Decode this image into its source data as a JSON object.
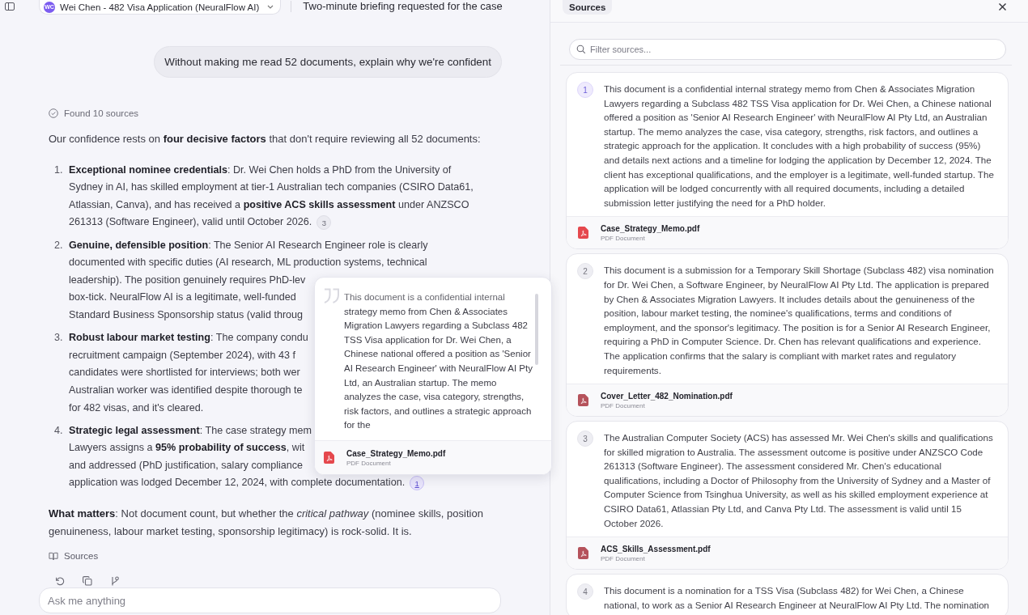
{
  "top_bar": {
    "case_selector": {
      "avatar": "WC",
      "label": "Wei Chen - 482 Visa Application (NeuralFlow AI)"
    },
    "title": "Two-minute briefing requested for the case"
  },
  "chat": {
    "user_message": "Without making me read 52 documents, explain why we're confident",
    "status": "Found 10 sources",
    "intro": "Our confidence rests on **four decisive factors** that don't require reviewing all 52 documents:",
    "factors": [
      {
        "number": "1.",
        "lines": [
          "**Exceptional nominee credentials**: Dr. Wei Chen holds a PhD from the University of",
          "Sydney in AI, has skilled employment at tier-1 Australian tech companies (CSIRO Data61,",
          "Atlassian, Canva), and has received a **positive ACS skills assessment** under ANZSCO",
          "261313 (Software Engineer), valid until October 2026."
        ],
        "citation": {
          "label": "3",
          "selected": false
        }
      },
      {
        "number": "2.",
        "lines": [
          "**Genuine, defensible position**: The Senior AI Research Engineer role is clearly",
          "documented with specific duties (AI research, ML production systems, technical",
          "leadership). The position genuinely requires PhD-lev",
          "box-tick. NeuralFlow AI is a legitimate, well-funded",
          "Standard Business Sponsorship status (valid throug"
        ]
      },
      {
        "number": "3.",
        "lines": [
          "**Robust labour market testing**: The company condu",
          "recruitment campaign (September 2024), with 43 f",
          "candidates were shortlisted for interviews; both wer",
          "Australian worker was identified despite thorough te",
          "for 482 visas, and it's cleared."
        ]
      },
      {
        "number": "4.",
        "lines": [
          "**Strategic legal assessment**: The case strategy mem",
          "Lawyers assigns a **95% probability of success**, wit",
          "and addressed (PhD justification, salary compliance",
          "application was lodged December 12, 2024, with complete documentation."
        ],
        "citation": {
          "label": "1",
          "selected": true
        }
      }
    ],
    "conclusion": "**What matters**: Not document count, but whether the *critical pathway* (nominee skills, position genuineness, labour market testing, sponsorship legitimacy) is rock-solid. It is.",
    "sources_link": "Sources",
    "input": {
      "placeholder": "Ask me anything"
    }
  },
  "citation_popover": {
    "excerpt": "This document is a confidential internal strategy memo from Chen & Associates Migration Lawyers regarding a Subclass 482 TSS Visa application for Dr. Wei Chen, a Chinese national offered a position as 'Senior AI Research Engineer' with NeuralFlow AI Pty Ltd, an Australian startup. The memo analyzes the case, visa category, strengths, risk factors, and outlines a strategic approach for the",
    "file": {
      "name": "Case_Strategy_Memo.pdf",
      "type": "PDF Document"
    }
  },
  "sources_panel": {
    "title": "Sources",
    "filter": {
      "placeholder": "Filter sources..."
    },
    "sources": [
      {
        "number": "1",
        "selected": true,
        "summary": "This document is a confidential internal strategy memo from Chen & Associates Migration Lawyers regarding a Subclass 482 TSS Visa application for Dr. Wei Chen, a Chinese national offered a position as 'Senior AI Research Engineer' with NeuralFlow AI Pty Ltd, an Australian startup. The memo analyzes the case, visa category, strengths, risk factors, and outlines a strategic approach for the application. It concludes with a high probability of success (95%) and details next actions and a timeline for lodging the application by December 12, 2024. The client has exceptional qualifications, and the employer is a legitimate, well-funded startup. The application will be lodged concurrently with all required documents, including a detailed submission letter justifying the need for a PhD holder.",
        "file": {
          "name": "Case_Strategy_Memo.pdf",
          "type": "PDF Document"
        }
      },
      {
        "number": "2",
        "selected": false,
        "summary": "This document is a submission for a Temporary Skill Shortage (Subclass 482) visa nomination for Dr. Wei Chen, a Software Engineer, by NeuralFlow AI Pty Ltd. The application is prepared by Chen & Associates Migration Lawyers. It includes details about the genuineness of the position, labour market testing, the nominee's qualifications, terms and conditions of employment, and the sponsor's legitimacy. The position is for a Senior AI Research Engineer, requiring a PhD in Computer Science. Dr. Chen has relevant qualifications and experience. The application confirms that the salary is compliant with market rates and regulatory requirements.",
        "file": {
          "name": "Cover_Letter_482_Nomination.pdf",
          "type": "PDF Document"
        }
      },
      {
        "number": "3",
        "selected": false,
        "summary": "The Australian Computer Society (ACS) has assessed Mr. Wei Chen's skills and qualifications for skilled migration to Australia. The assessment outcome is positive under ANZSCO Code 261313 (Software Engineer). The assessment considered Mr. Chen's educational qualifications, including a Doctor of Philosophy from the University of Sydney and a Master of Computer Science from Tsinghua University, as well as his skilled employment experience at CSIRO Data61, Atlassian Pty Ltd, and Canva Pty Ltd. The assessment is valid until 15 October 2026.",
        "file": {
          "name": "ACS_Skills_Assessment.pdf",
          "type": "PDF Document"
        }
      },
      {
        "number": "4",
        "selected": false,
        "summary": "This document is a nomination for a TSS Visa (Subclass 482) for Wei Chen, a Chinese national, to work as a Senior AI Research Engineer at NeuralFlow AI Pty Ltd. The nomination"
      }
    ]
  }
}
